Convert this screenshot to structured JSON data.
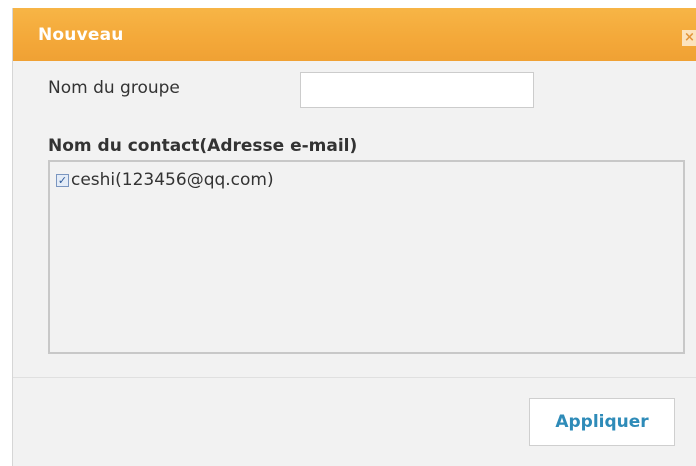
{
  "dialog": {
    "title": "Nouveau",
    "close_icon": "close-icon",
    "close_glyph": "×"
  },
  "form": {
    "group_label": "Nom du groupe",
    "group_value": "",
    "contact_label": "Nom du contact(Adresse e-mail)",
    "contacts": [
      {
        "label": "ceshi(123456@qq.com)",
        "checked": true,
        "check_glyph": "✓"
      }
    ]
  },
  "actions": {
    "apply_label": "Appliquer"
  },
  "colors": {
    "title_bar": "#f4a93a",
    "apply_text": "#2e8bb8"
  }
}
